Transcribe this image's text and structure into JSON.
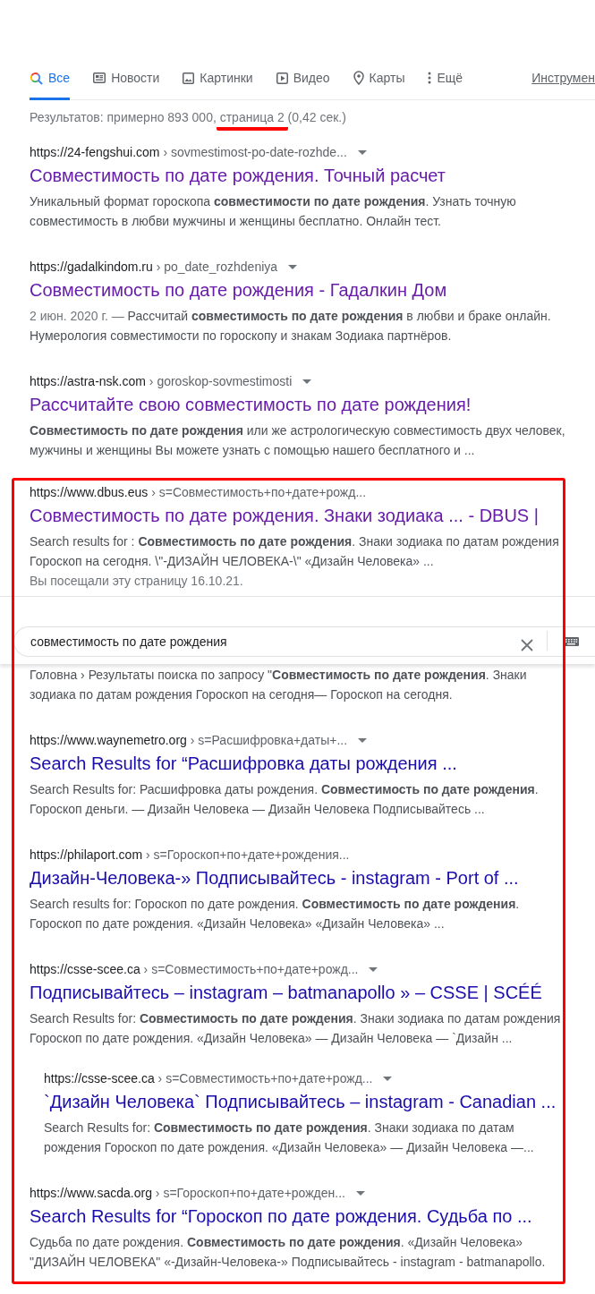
{
  "tabs": [
    {
      "label": "Все",
      "kind": "search",
      "selected": true
    },
    {
      "label": "Новости",
      "kind": "news",
      "selected": false
    },
    {
      "label": "Картинки",
      "kind": "images",
      "selected": false
    },
    {
      "label": "Видео",
      "kind": "video",
      "selected": false
    },
    {
      "label": "Карты",
      "kind": "maps",
      "selected": false
    },
    {
      "label": "Ещё",
      "kind": "more",
      "selected": false
    }
  ],
  "tools_label": "Инструмен",
  "stats": {
    "before": "Результатов: примерно 893 000, ",
    "marked": "страница 2",
    "after": " (0,42 сек.)"
  },
  "results": [
    {
      "host": "https://24-fengshui.com",
      "path": "› sovmestimost-po-date-rozhde...",
      "caret": true,
      "title": "Совместимость по дате рождения. Точный расчет",
      "visited": true,
      "snippet": "Уникальный формат гороскопа **совместимости по дате рождения**. Узнать точную совместимость в любви мужчины и женщины бесплатно. Онлайн тест."
    },
    {
      "host": "https://gadalkindom.ru",
      "path": "› po_date_rozhdeniya",
      "caret": true,
      "title": "Совместимость по дате рождения - Гадалкин Дом",
      "visited": true,
      "date": "2 июн. 2020 г. — ",
      "snippet": "Рассчитай **совместимость по дате рождения** в любви и браке онлайн. Нумерология совместимости по гороскопу и знакам Зодиака партнёров."
    },
    {
      "host": "https://astra-nsk.com",
      "path": "› goroskop-sovmestimosti",
      "caret": true,
      "title": "Рассчитайте свою совместимость по дате рождения!",
      "visited": true,
      "snippet": "**Совместимость по дате рождения** или же астрологическую совместимость двух человек, мужчины и женщины Вы можете узнать с помощью нашего бесплатного и ..."
    }
  ],
  "framed_results": [
    {
      "host": "https://www.dbus.eus",
      "path": "› s=Совместимость+по+дате+рожд...",
      "caret": false,
      "title": "Совместимость по дате рождения. Знаки зодиака ... - DBUS |",
      "visited": true,
      "snippet": "Search results for : **Совместимость по дате рождения**. Знаки зодиака по датам рождения Гороскоп на сегодня. \\\"-ДИЗАЙН ЧЕЛОВЕКА-\\\" «Дизайн Человека» ...",
      "note": "Вы посещали эту страницу 16.10.21."
    },
    {
      "snippet": "Головна › Результаты поиска по запросу \"**Совместимость по дате рождения**. Знаки зодиака по датам рождения Гороскоп на сегодня— Гороскоп на сегодня."
    },
    {
      "host": "https://www.waynemetro.org",
      "path": "› s=Расшифровка+даты+...",
      "caret": true,
      "title": "Search Results for “Расшифровка даты рождения ...",
      "visited": false,
      "snippet": "Search Results for: Расшифровка даты рождения. **Совместимость по дате рождения**. Гороскоп деньги. — Дизайн Человека — Дизайн Человека Подписывайтесь ..."
    },
    {
      "host": "https://philaport.com",
      "path": "› s=Гороскоп+по+дате+рождения...",
      "caret": false,
      "title": "Дизайн-Человека-» Подписывайтесь - instagram - Port of ...",
      "visited": false,
      "snippet": "Search results for: Гороскоп по дате рождения. **Совместимость по дате рождения**. Гороскоп по дате рождения. «Дизайн Человека» «Дизайн Человека» ..."
    },
    {
      "host": "https://csse-scee.ca",
      "path": "› s=Совместимость+по+дате+рожд...",
      "caret": true,
      "title": "Подписывайтесь – instagram – batmanapollo » – CSSE | SCÉÉ",
      "visited": false,
      "snippet": "Search Results for: **Совместимость по дате рождения**. Знаки зодиака по датам рождения Гороскоп по дате рождения. «Дизайн Человека» — Дизайн Человека — `Дизайн ...",
      "children": [
        {
          "host": "https://csse-scee.ca",
          "path": "› s=Совместимость+по+дате+рожд...",
          "caret": true,
          "title": "`Дизайн Человека` Подписывайтесь – instagram - Canadian ...",
          "visited": false,
          "snippet": "Search Results for: **Совместимость по дате рождения**. Знаки зодиака по датам рождения Гороскоп по дате рождения. «Дизайн Человека» — Дизайн Человека —..."
        }
      ]
    },
    {
      "host": "https://www.sacda.org",
      "path": "› s=Гороскоп+по+дате+рожден...",
      "caret": true,
      "title": "Search Results for “Гороскоп по дате рождения. Судьба по ...",
      "visited": false,
      "snippet": "Судьба по дате рождения. **Совместимость по дате рождения**. «Дизайн Человека» \"ДИЗАЙН ЧЕЛОВЕКА\" «-Дизайн-Человека-» Подписывайтесь - instagram - batmanapollo."
    }
  ],
  "search_bar": {
    "value": "совместимость по дате рождения"
  }
}
